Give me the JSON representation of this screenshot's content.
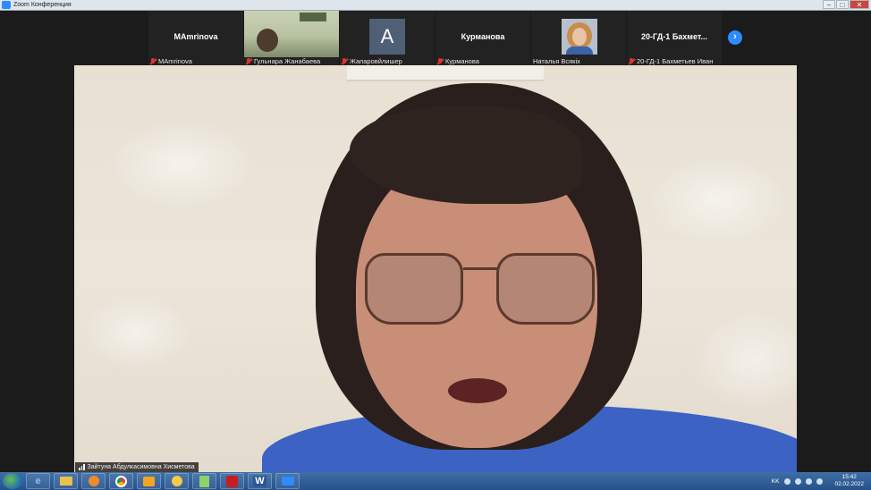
{
  "window": {
    "title": "Zoom Конференция",
    "minimize": "–",
    "maximize": "□",
    "close": "✕"
  },
  "participants": [
    {
      "big": "MAmrinova",
      "label": "MAmrinova",
      "muted": true
    },
    {
      "label": "Гульнара Жанабаева",
      "muted": true
    },
    {
      "avatar_letter": "A",
      "label": "Жапаровйлишер",
      "muted": true
    },
    {
      "big": "Курманова",
      "label": "Курманова",
      "muted": true
    },
    {
      "label": "Наталья Всякіх",
      "muted": false
    },
    {
      "big": "20-ГД-1 Бахмет...",
      "label": "20-ГД-1 Бахметьев Иван",
      "muted": true
    }
  ],
  "next_page": "›",
  "speaker": {
    "name": "Зайтуна Абдулкасимовна Хисметова"
  },
  "taskbar": {
    "apps": [
      "ie-icon",
      "explorer-icon",
      "media-player-icon",
      "chrome-icon",
      "outlook-icon",
      "yandex-icon",
      "calculator-icon",
      "acrobat-icon",
      "word-icon",
      "zoom-icon"
    ],
    "word_label": "W",
    "language": "KK",
    "time": "15:42",
    "date": "02.02.2022"
  },
  "colors": {
    "accent": "#2d8cff",
    "muted_mic": "#dd3333",
    "taskbar": "#26518a",
    "blazer": "#3c63c4"
  }
}
